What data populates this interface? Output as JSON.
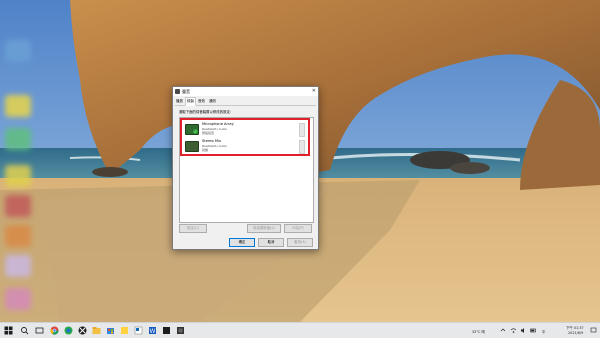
{
  "dialog": {
    "title": "聲音",
    "close_glyph": "✕",
    "tabs": [
      "播放",
      "錄製",
      "音效",
      "通訊"
    ],
    "active_tab_index": 1,
    "instruction": "選取下面的錄音裝置以修改其設定:",
    "devices": [
      {
        "name": "Microphone Array",
        "driver": "Realtek(R) Audio",
        "status": "預設裝置",
        "icon": "microphone-icon",
        "is_default": true
      },
      {
        "name": "Stereo Mix",
        "driver": "Realtek(R) Audio",
        "status": "就緒",
        "icon": "stereo-mix-icon",
        "is_default": false
      }
    ],
    "highlight_color": "#e0202a",
    "buttons": {
      "configure": "設定(C)",
      "set_default": "設為預設值(S)",
      "properties": "內容(P)",
      "ok": "確定",
      "cancel": "取消",
      "apply": "套用(A)"
    }
  },
  "taskbar": {
    "weather": "33°C 晴",
    "tray_ime": "中",
    "clock_time": "下午 01:37",
    "clock_date": "2021/6/9",
    "icons": [
      "windows-start-icon",
      "search-icon",
      "task-view-icon",
      "chrome-icon",
      "edge-icon",
      "xbox-icon",
      "file-explorer-icon",
      "store-icon",
      "sticky-notes-icon",
      "outlook-icon",
      "word-icon",
      "terminal-icon",
      "app-icon"
    ]
  },
  "colors": {
    "accent": "#0078d7",
    "taskbar_bg": "#e6e8ea"
  }
}
